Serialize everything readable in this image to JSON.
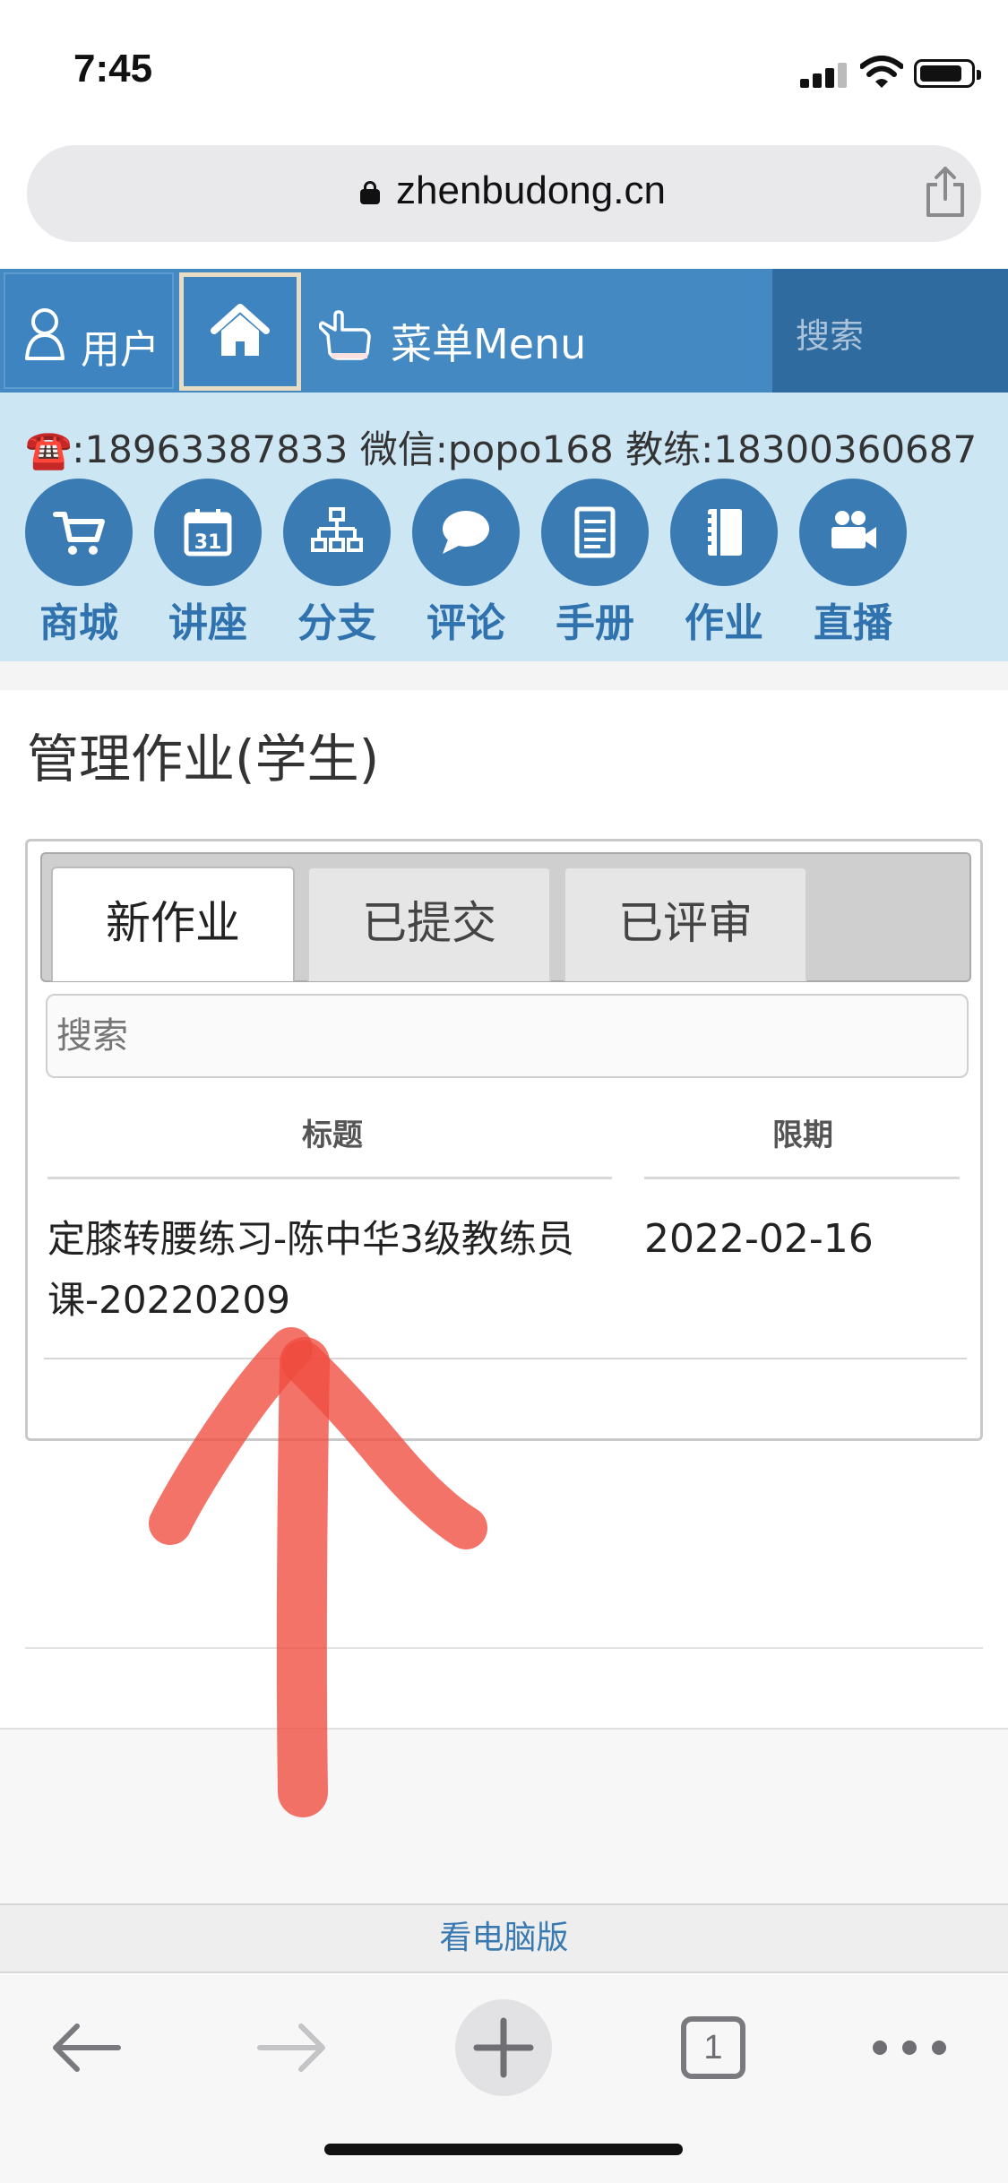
{
  "status_bar": {
    "time": "7:45"
  },
  "browser": {
    "url": "zhenbudong.cn"
  },
  "nav": {
    "user_label": "用户",
    "menu_label": "菜单Menu",
    "search_placeholder": "搜索"
  },
  "contact": {
    "phone_icon": "☎️",
    "text": ":18963387833 微信:popo168 教练:18300360687"
  },
  "quick_links": [
    {
      "label": "商城",
      "icon": "cart-icon"
    },
    {
      "label": "讲座",
      "icon": "calendar-icon"
    },
    {
      "label": "分支",
      "icon": "sitemap-icon"
    },
    {
      "label": "评论",
      "icon": "comment-icon"
    },
    {
      "label": "手册",
      "icon": "book-icon"
    },
    {
      "label": "作业",
      "icon": "notebook-icon"
    },
    {
      "label": "直播",
      "icon": "video-camera-icon"
    }
  ],
  "page_title": "管理作业(学生)",
  "tabs": [
    {
      "label": "新作业",
      "active": true
    },
    {
      "label": "已提交",
      "active": false
    },
    {
      "label": "已评审",
      "active": false
    }
  ],
  "table": {
    "search_placeholder": "搜索",
    "headers": {
      "title": "标题",
      "deadline": "限期"
    },
    "rows": [
      {
        "title": "定膝转腰练习-陈中华3级教练员课-20220209",
        "deadline": "2022-02-16"
      }
    ]
  },
  "footer": {
    "desktop_link": "看电脑版"
  },
  "toolbar": {
    "tabs_count": "1"
  },
  "colors": {
    "nav_blue": "#4589c3",
    "band_light_blue": "#cde6f4",
    "icon_blue": "#3b7bb4",
    "annotation_red": "#ef4b3f"
  }
}
